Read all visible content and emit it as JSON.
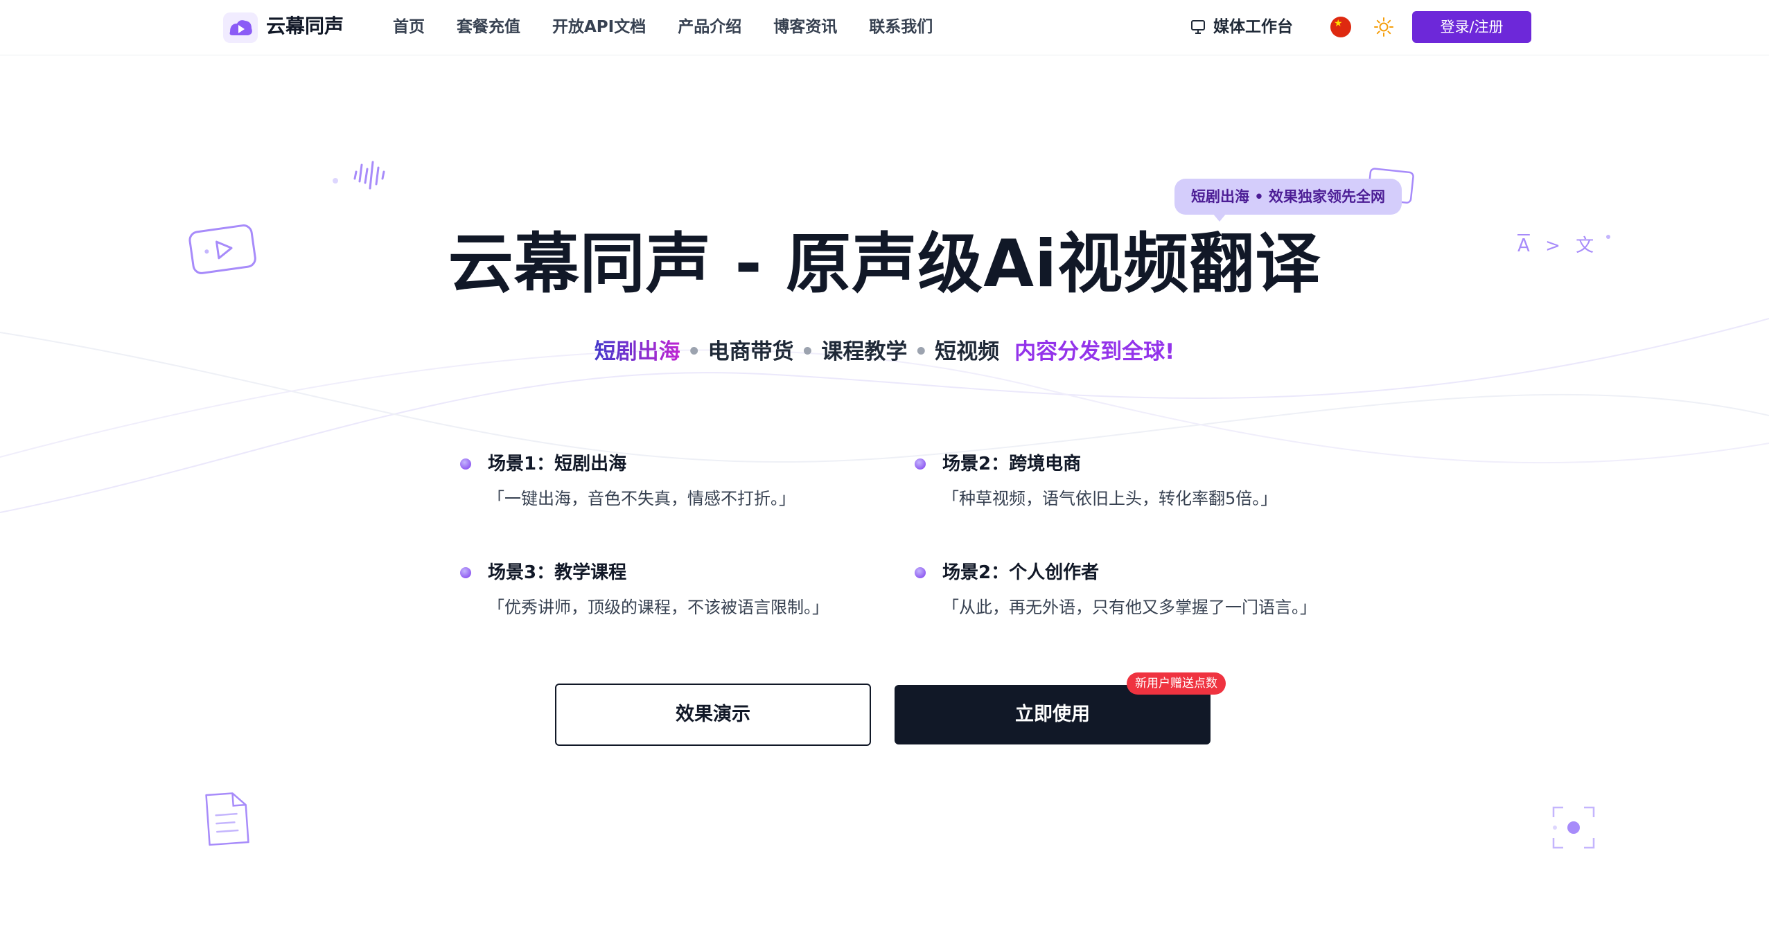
{
  "header": {
    "brand": "云幕同声",
    "nav": [
      "首页",
      "套餐充值",
      "开放API文档",
      "产品介绍",
      "博客资讯",
      "联系我们"
    ],
    "workbench_label": "媒体工作台",
    "language_icon": "china-flag-icon",
    "theme_icon": "sun-icon",
    "login_label": "登录/注册"
  },
  "hero": {
    "badge": "短剧出海 • 效果独家领先全网",
    "title": "云幕同声 - 原声级Ai视频翻译",
    "subtitle": {
      "item1": "短剧出海",
      "item2": "电商带货",
      "item3": "课程教学",
      "item4": "短视频",
      "cta": "内容分发到全球!",
      "separator": "•"
    },
    "translate_deco": {
      "from": "A",
      "arrow": ">",
      "to": "文"
    }
  },
  "scenarios": [
    {
      "title": "场景1：短剧出海",
      "quote": "「一键出海，音色不失真，情感不打折。」"
    },
    {
      "title": "场景2：跨境电商",
      "quote": "「种草视频，语气依旧上头，转化率翻5倍。」"
    },
    {
      "title": "场景3：教学课程",
      "quote": "「优秀讲师，顶级的课程，不该被语言限制。」"
    },
    {
      "title": "场景2：个人创作者",
      "quote": "「从此，再无外语，只有他又多掌握了一门语言。」"
    }
  ],
  "actions": {
    "demo_label": "效果演示",
    "use_label": "立即使用",
    "promo_badge": "新用户赠送点数"
  },
  "colors": {
    "primary": "#6d28d9",
    "dark": "#111827",
    "badge_bg": "#d4cdfb",
    "promo": "#ef3340",
    "accent_purple": "#9333ea"
  }
}
